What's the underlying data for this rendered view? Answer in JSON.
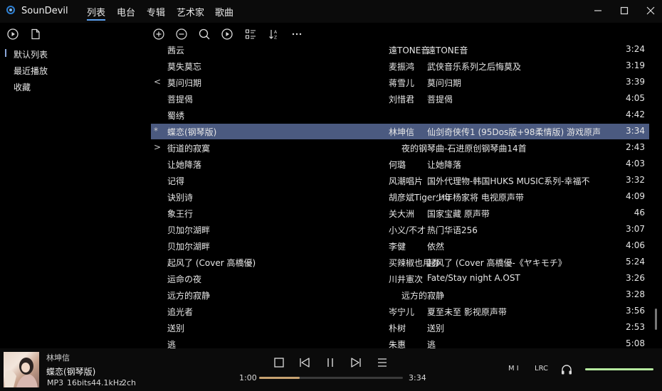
{
  "app": {
    "title": "SounDevil"
  },
  "nav": {
    "tabs": [
      "列表",
      "电台",
      "专辑",
      "艺术家",
      "歌曲"
    ],
    "active": 0
  },
  "sidebar": {
    "items": [
      "默认列表",
      "最近播放",
      "收藏"
    ],
    "active": 0
  },
  "tracks": [
    {
      "mark": "",
      "title": "茜云",
      "artist": "遠TONE音",
      "album": "遠TONE音",
      "duration": "3:24"
    },
    {
      "mark": "",
      "title": "莫失莫忘",
      "artist": "麦振鸿",
      "album": "武侠音乐系列之后悔莫及",
      "duration": "3:19"
    },
    {
      "mark": "<",
      "title": "莫问归期",
      "artist": "蒋雪儿",
      "album": "莫问归期",
      "duration": "3:39"
    },
    {
      "mark": "",
      "title": "菩提偈",
      "artist": "刘惜君",
      "album": "菩提偈",
      "duration": "4:05"
    },
    {
      "mark": "",
      "title": "蜀绣",
      "artist": "",
      "album": "",
      "duration": "4:42"
    },
    {
      "mark": "*",
      "title": "蝶恋(钢琴版)",
      "artist": "林坤信",
      "album": "仙剑奇侠传1 (95Dos版+98柔情版) 游戏原声",
      "duration": "3:34",
      "selected": true
    },
    {
      "mark": ">",
      "title": "街道的寂寞",
      "artist": "",
      "album": "夜的钢琴曲-石进原创钢琴曲14首",
      "duration": "2:43"
    },
    {
      "mark": "",
      "title": "让她降落",
      "artist": "何璐",
      "album": "让她降落",
      "duration": "4:03"
    },
    {
      "mark": "",
      "title": "记得",
      "artist": "风潮唱片",
      "album": "国外代理物-韩国HUKS MUSIC系列-幸福不",
      "duration": "3:32"
    },
    {
      "mark": "",
      "title": "诀别诗",
      "artist": "胡彦斌Tiger Hu",
      "album": "少年杨家将 电视原声带",
      "duration": "4:09"
    },
    {
      "mark": "",
      "title": "象王行",
      "artist": "关大洲",
      "album": "国家宝藏 原声带",
      "duration": "46"
    },
    {
      "mark": "",
      "title": "贝加尔湖畔",
      "artist": "小义/不才",
      "album": "热门华语256",
      "duration": "3:07"
    },
    {
      "mark": "",
      "title": "贝加尔湖畔",
      "artist": "李健",
      "album": "依然",
      "duration": "4:06"
    },
    {
      "mark": "",
      "title": "起风了 (Cover 高橋優)",
      "artist": "买辣椒也用券",
      "album": "起风了 (Cover 高橋優-《ヤキモチ》",
      "duration": "5:24"
    },
    {
      "mark": "",
      "title": "运命の夜",
      "artist": "川井憲次",
      "album": "Fate/Stay night A.OST",
      "duration": "3:26"
    },
    {
      "mark": "",
      "title": "远方的寂静",
      "artist": "",
      "album": "远方的寂静",
      "duration": "3:28"
    },
    {
      "mark": "",
      "title": "追光者",
      "artist": "岑宁儿",
      "album": "夏至未至 影视原声带",
      "duration": "3:56"
    },
    {
      "mark": "",
      "title": "送别",
      "artist": "朴树",
      "album": "送别",
      "duration": "2:53"
    },
    {
      "mark": "",
      "title": "逃",
      "artist": "朱惠",
      "album": "逃",
      "duration": "5:08"
    }
  ],
  "now_playing": {
    "artist": "林坤信",
    "title": "蝶恋(钢琴版)",
    "format": "MP3",
    "bits": "16bits",
    "rate": "44.1kHz",
    "channels": "2ch",
    "elapsed": "1:00",
    "total": "3:34",
    "progress": 0.28
  },
  "tools": {
    "mi_label": "M I",
    "lrc_label": "LRC",
    "volume": 1.0
  },
  "colors": {
    "accent": "#5aa0f0",
    "selected_row": "#4b5a80",
    "progress": "#c7a271",
    "volume": "#b6eaa0"
  }
}
